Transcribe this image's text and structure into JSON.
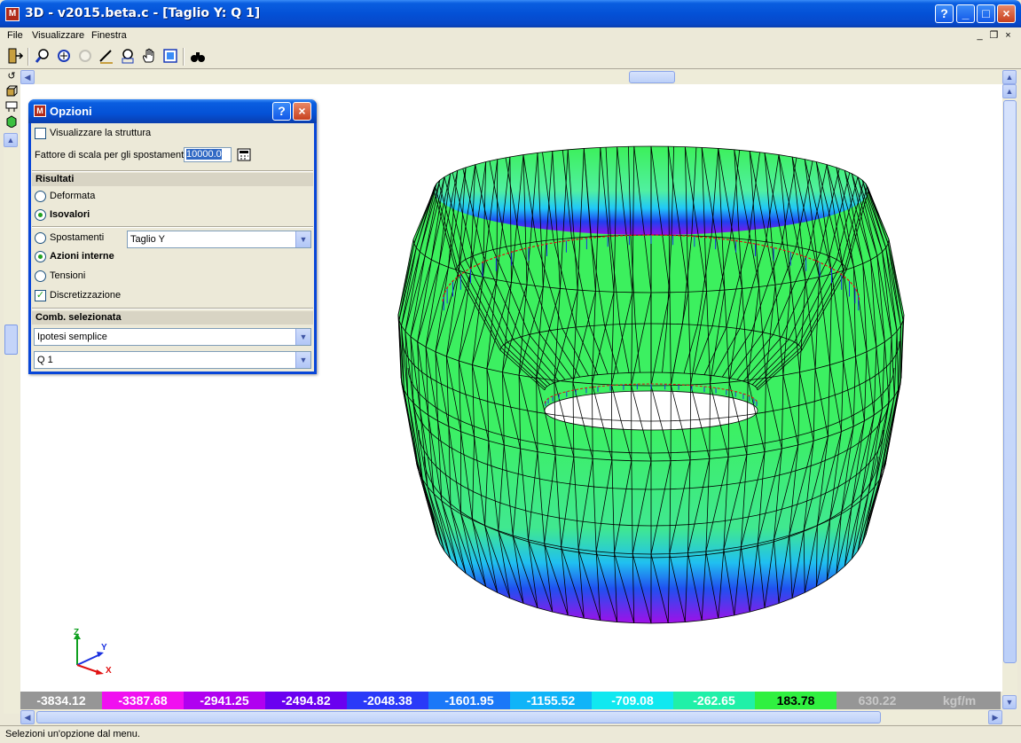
{
  "window": {
    "title": "3D - v2015.beta.c - [Taglio Y: Q 1]",
    "buttons": [
      "?",
      "_",
      "□",
      "×"
    ]
  },
  "menu": {
    "items": [
      "File",
      "Visualizzare",
      "Finestra"
    ],
    "mdi_controls": [
      "_",
      "❐",
      "×"
    ]
  },
  "toolbar": {
    "icons": [
      "exit-icon",
      "zoom-icon",
      "zoom-window-icon",
      "zoom-previous-icon",
      "measure-icon",
      "zoom-all-icon",
      "pan-hand-icon",
      "redraw-icon",
      "binoculars-icon"
    ]
  },
  "side_tools": {
    "icons": [
      "rotate-icon",
      "box-view-icon",
      "plane-view-icon",
      "shade-view-icon"
    ]
  },
  "dialog": {
    "title": "Opzioni",
    "show_structure_label": "Visualizzare la struttura",
    "show_structure_checked": false,
    "scale_label": "Fattore di scala per gli spostamenti",
    "scale_value": "10000.0",
    "results_header": "Risultati",
    "deformed_label": "Deformata",
    "isovalues_label": "Isovalori",
    "displacements_label": "Spostamenti",
    "quantity_select": "Taglio Y",
    "internal_actions_label": "Azioni interne",
    "stresses_label": "Tensioni",
    "discretization_label": "Discretizzazione",
    "discretization_checked": true,
    "combination_header": "Comb. selezionata",
    "combination_type": "Ipotesi semplice",
    "combination_case": "Q 1"
  },
  "axes": {
    "z": "Z",
    "y": "Y",
    "x": "X"
  },
  "legend": {
    "values": [
      "-3834.12",
      "-3387.68",
      "-2941.25",
      "-2494.82",
      "-2048.38",
      "-1601.95",
      "-1155.52",
      "-709.08",
      "-262.65",
      "183.78",
      "630.22"
    ],
    "unit": "kgf/m",
    "colors": [
      "#969696",
      "#f010f0",
      "#b000f0",
      "#6a00f0",
      "#2a3af8",
      "#1a78f8",
      "#10b4f8",
      "#10e8f0",
      "#20f0a8",
      "#30f040",
      "#969696"
    ]
  },
  "status": {
    "text": "Selezioni un'opzione dal menu."
  },
  "colors": {
    "mesh_green": "#3cf05a",
    "mesh_blue": "#1a40f0",
    "mesh_purple": "#9a10e8",
    "load_red": "#e01010"
  }
}
